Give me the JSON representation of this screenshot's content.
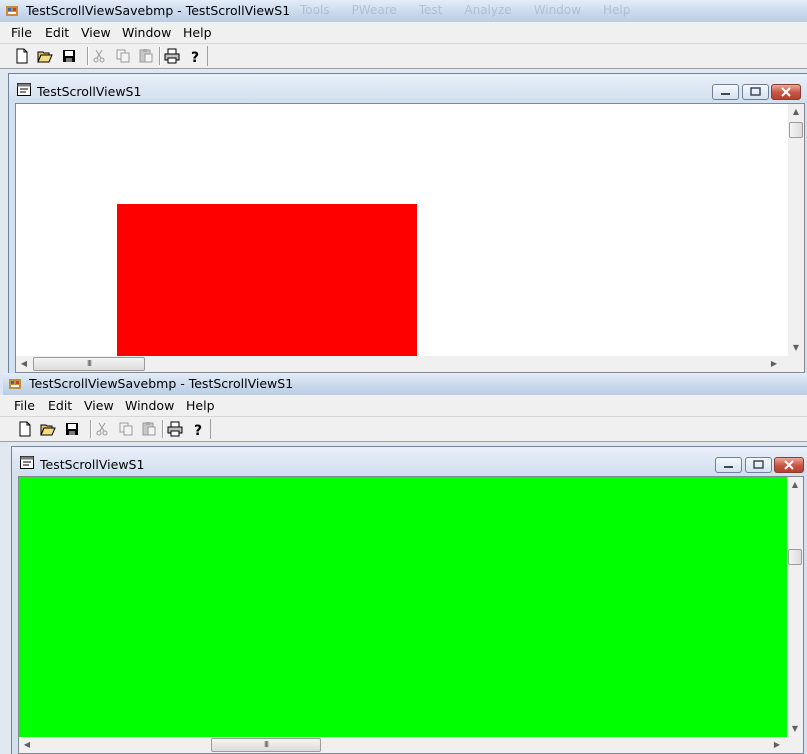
{
  "windows": [
    {
      "title": "TestScrollViewSavebmp - TestScrollViewS1",
      "ghost_menu": [
        "Tools",
        "PWeare",
        "Test",
        "Analyze",
        "Window",
        "Help"
      ],
      "menu": [
        "File",
        "Edit",
        "View",
        "Window",
        "Help"
      ],
      "toolbar": [
        "new-icon",
        "open-icon",
        "save-icon",
        "cut-icon",
        "copy-icon",
        "paste-icon",
        "print-icon",
        "help-icon"
      ],
      "child_title": "TestScrollViewS1",
      "content": {
        "shape": "rectangle",
        "color": "#ff0000",
        "background": "#ffffff"
      },
      "hscroll_thumb": "III"
    },
    {
      "title": "TestScrollViewSavebmp - TestScrollViewS1",
      "menu": [
        "File",
        "Edit",
        "View",
        "Window",
        "Help"
      ],
      "toolbar": [
        "new-icon",
        "open-icon",
        "save-icon",
        "cut-icon",
        "copy-icon",
        "paste-icon",
        "print-icon",
        "help-icon"
      ],
      "child_title": "TestScrollViewS1",
      "content": {
        "background": "#00ff00"
      },
      "hscroll_thumb": "III"
    }
  ]
}
